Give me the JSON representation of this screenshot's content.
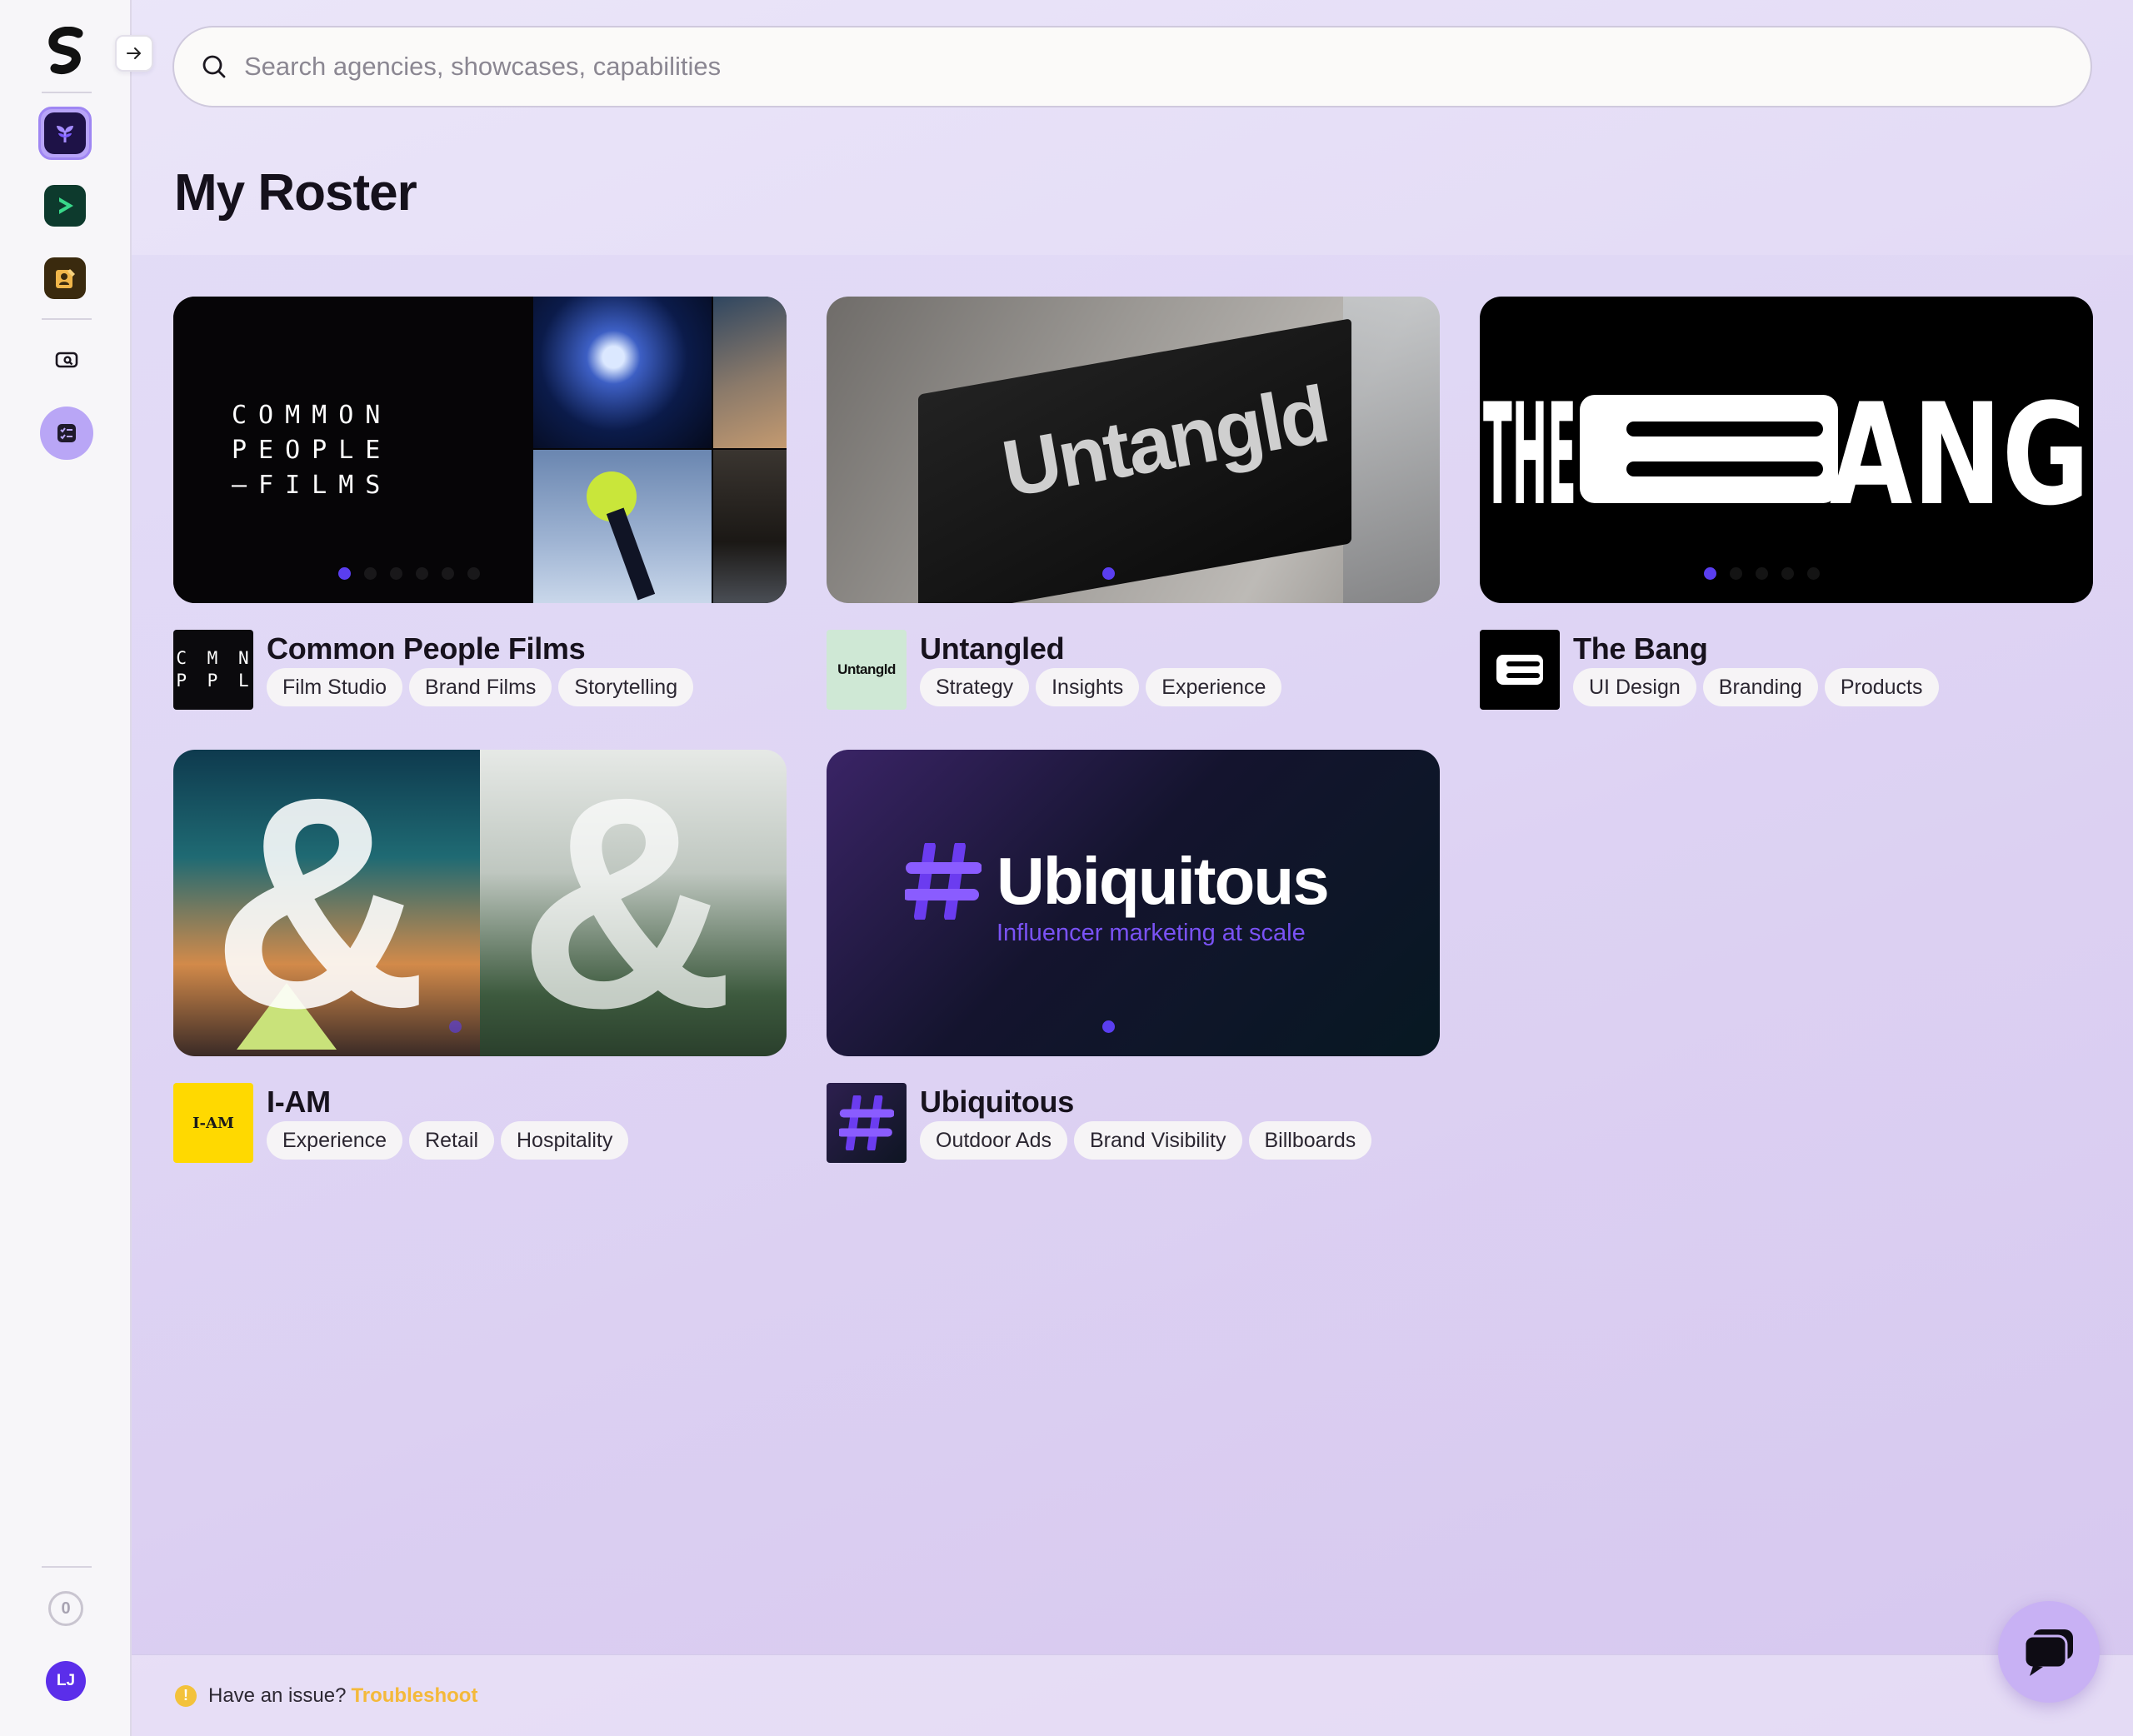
{
  "sidebar": {
    "credits_count": "0",
    "avatar_initials": "LJ"
  },
  "search": {
    "placeholder": "Search agencies, showcases, capabilities"
  },
  "page": {
    "title": "My Roster"
  },
  "cards": [
    {
      "name": "Common People Films",
      "logo_text": "C M N\nP P L",
      "thumb_text": "COMMON\nPEOPLE\n–FILMS",
      "tags": [
        "Film Studio",
        "Brand Films",
        "Storytelling"
      ]
    },
    {
      "name": "Untangled",
      "logo_text": "Untangld",
      "thumb_text": "Untangld",
      "tags": [
        "Strategy",
        "Insights",
        "Experience"
      ]
    },
    {
      "name": "The Bang",
      "logo_text": "B",
      "thumb_text": "THEBANG",
      "tags": [
        "UI Design",
        "Branding",
        "Products"
      ]
    },
    {
      "name": "I-AM",
      "logo_text": "I-AM",
      "thumb_text": "&",
      "tags": [
        "Experience",
        "Retail",
        "Hospitality"
      ]
    },
    {
      "name": "Ubiquitous",
      "logo_text": "#",
      "thumb_title": "Ubiquitous",
      "thumb_subtitle": "Influencer marketing at scale",
      "tags": [
        "Outdoor Ads",
        "Brand Visibility",
        "Billboards"
      ]
    }
  ],
  "footer": {
    "text": "Have an issue?",
    "link": "Troubleshoot"
  },
  "colors": {
    "accent": "#5a3ef0",
    "footer_link": "#f4b93a",
    "iam_yellow": "#ffd900"
  }
}
